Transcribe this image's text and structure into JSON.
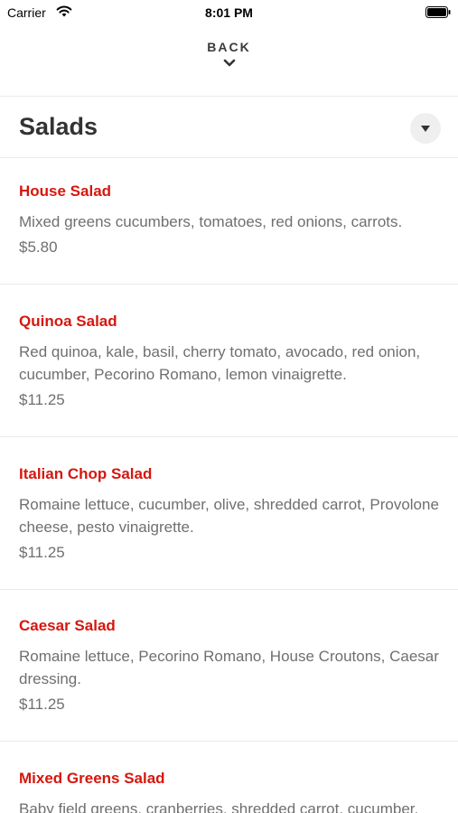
{
  "status_bar": {
    "carrier": "Carrier",
    "time": "8:01 PM"
  },
  "nav": {
    "back_label": "BACK"
  },
  "category": {
    "title": "Salads"
  },
  "colors": {
    "accent": "#d5170e",
    "text_muted": "#6f6f6f",
    "divider": "#e9e9e9"
  },
  "icons": [
    "wifi-icon",
    "battery-icon",
    "chevron-down-icon",
    "dropdown-triangle-icon"
  ],
  "items": [
    {
      "name": "House Salad",
      "description": "Mixed greens cucumbers, tomatoes, red onions, carrots.",
      "price": "$5.80"
    },
    {
      "name": "Quinoa Salad",
      "description": "Red quinoa, kale, basil, cherry tomato, avocado, red onion, cucumber, Pecorino Romano, lemon vinaigrette.",
      "price": "$11.25"
    },
    {
      "name": "Italian Chop Salad",
      "description": "Romaine lettuce, cucumber, olive, shredded carrot, Provolone cheese, pesto vinaigrette.",
      "price": "$11.25"
    },
    {
      "name": "Caesar Salad",
      "description": "Romaine lettuce, Pecorino Romano, House Croutons, Caesar dressing.",
      "price": "$11.25"
    },
    {
      "name": "Mixed Greens Salad",
      "description": "Baby field greens, cranberries, shredded carrot, cucumber,"
    }
  ]
}
